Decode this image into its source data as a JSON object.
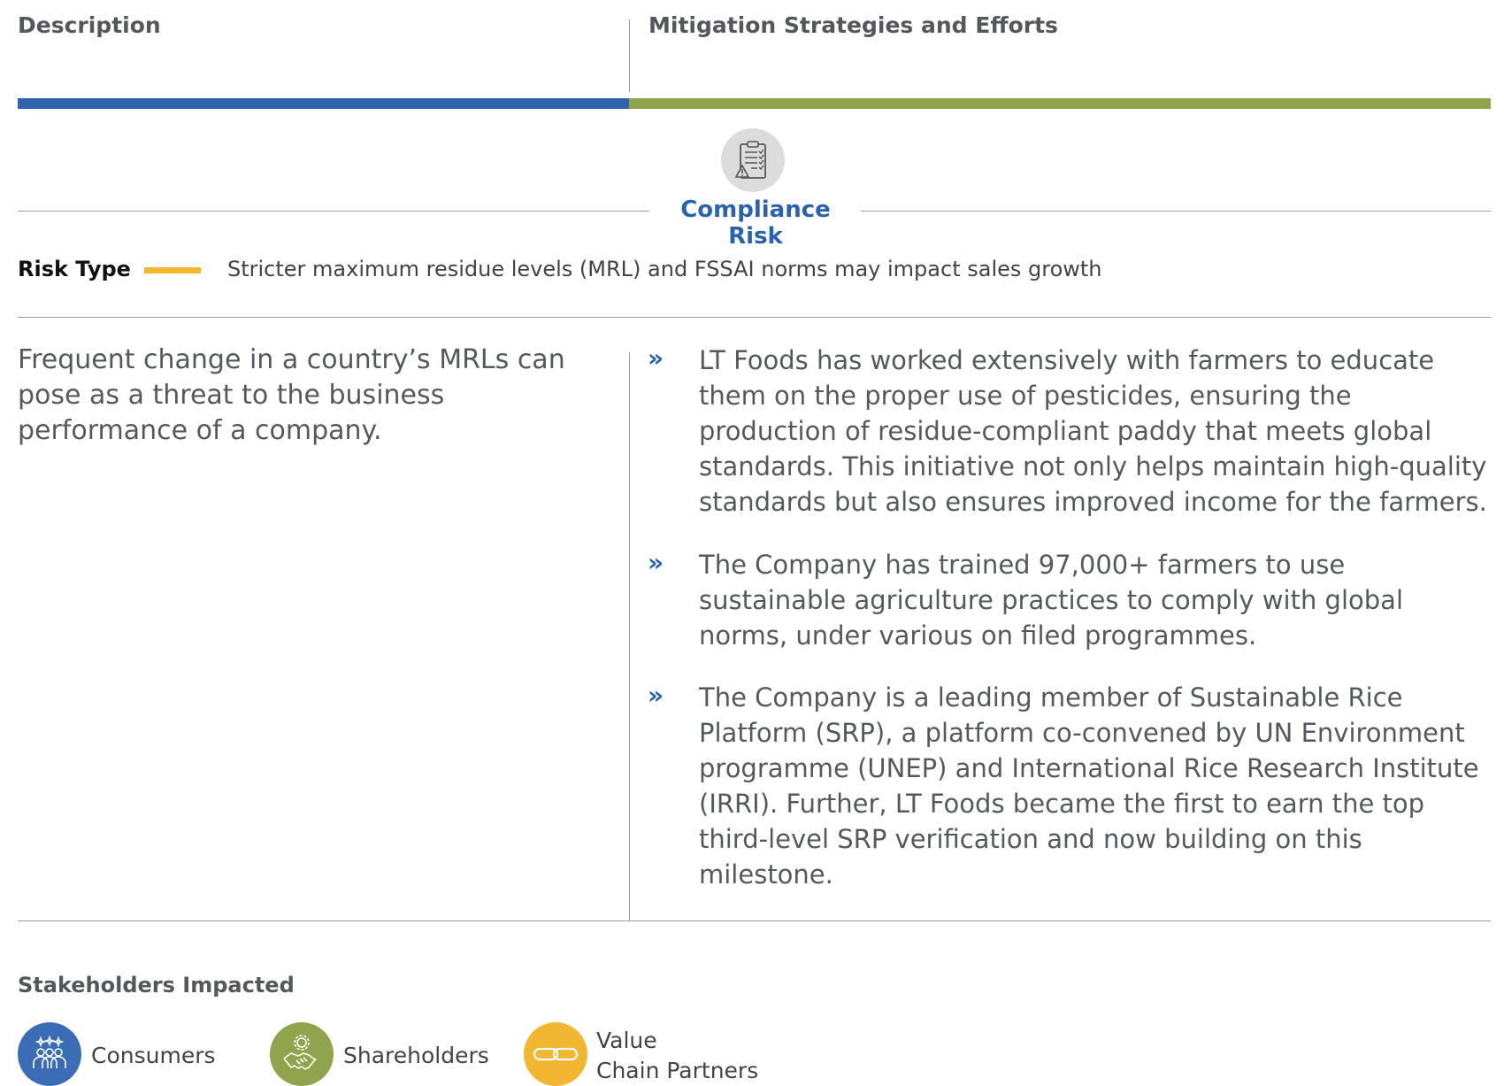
{
  "columns": {
    "left_header": "Description",
    "right_header": "Mitigation Strategies and Efforts"
  },
  "colors": {
    "blue": "#2f63ad",
    "green": "#8fa44b",
    "yellow": "#f2b731",
    "title_blue": "#2a63ad"
  },
  "risk": {
    "icon": "clipboard-checklist-warning-icon",
    "title": "Compliance Risk",
    "type_label": "Risk Type",
    "type_text": "Stricter maximum residue levels (MRL) and FSSAI norms may impact sales growth"
  },
  "description": "Frequent change in a country’s MRLs can pose as a threat to the business performance of a company.",
  "mitigation": [
    {
      "bullet": "»",
      "text": "LT Foods has worked extensively with farmers to educate them on the proper use of pesticides, ensuring the production of residue-compliant paddy that meets global standards. This initiative not only helps maintain high-quality standards but also ensures improved income for the farmers."
    },
    {
      "bullet": "»",
      "text": "The Company has trained 97,000+ farmers to use sustainable agriculture practices to comply with global norms, under various on filed programmes."
    },
    {
      "bullet": "»",
      "text": "The Company is a leading member of Sustainable Rice Platform (SRP), a platform co-convened by UN Environment programme (UNEP) and International Rice Research Institute (IRRI). Further, LT Foods became the first to earn the top third-level SRP verification and now building on this milestone."
    }
  ],
  "stakeholders": {
    "title": "Stakeholders Impacted",
    "items": [
      {
        "icon": "consumers-group-icon",
        "label": "Consumers"
      },
      {
        "icon": "shareholders-handshake-icon",
        "label": "Shareholders"
      },
      {
        "icon": "chain-link-icon",
        "label_line1": "Value",
        "label_line2": "Chain Partners"
      }
    ]
  }
}
